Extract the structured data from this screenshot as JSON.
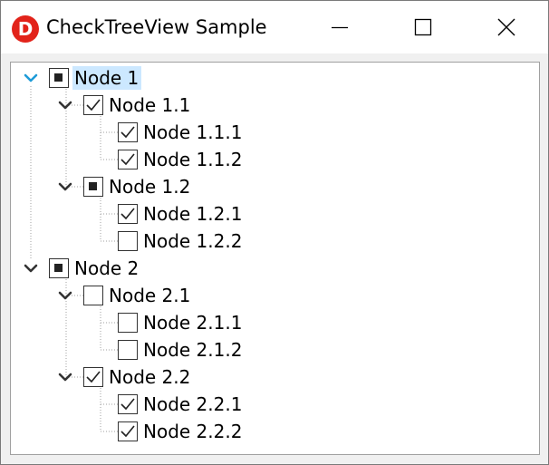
{
  "window": {
    "title": "CheckTreeView Sample",
    "app_icon_letter": "D",
    "accent_color": "#e2231a",
    "selection_color": "#cce8ff"
  },
  "tree": {
    "nodes": [
      {
        "label": "Node 1",
        "state": "indeterminate",
        "level": 0,
        "expanded": true,
        "selected": true
      },
      {
        "label": "Node 1.1",
        "state": "checked",
        "level": 1,
        "expanded": true
      },
      {
        "label": "Node 1.1.1",
        "state": "checked",
        "level": 2
      },
      {
        "label": "Node 1.1.2",
        "state": "checked",
        "level": 2
      },
      {
        "label": "Node 1.2",
        "state": "indeterminate",
        "level": 1,
        "expanded": true
      },
      {
        "label": "Node 1.2.1",
        "state": "checked",
        "level": 2
      },
      {
        "label": "Node 1.2.2",
        "state": "unchecked",
        "level": 2
      },
      {
        "label": "Node 2",
        "state": "indeterminate",
        "level": 0,
        "expanded": true
      },
      {
        "label": "Node 2.1",
        "state": "unchecked",
        "level": 1,
        "expanded": true
      },
      {
        "label": "Node 2.1.1",
        "state": "unchecked",
        "level": 2
      },
      {
        "label": "Node 2.1.2",
        "state": "unchecked",
        "level": 2
      },
      {
        "label": "Node 2.2",
        "state": "checked",
        "level": 1,
        "expanded": true
      },
      {
        "label": "Node 2.2.1",
        "state": "checked",
        "level": 2
      },
      {
        "label": "Node 2.2.2",
        "state": "checked",
        "level": 2
      }
    ]
  }
}
